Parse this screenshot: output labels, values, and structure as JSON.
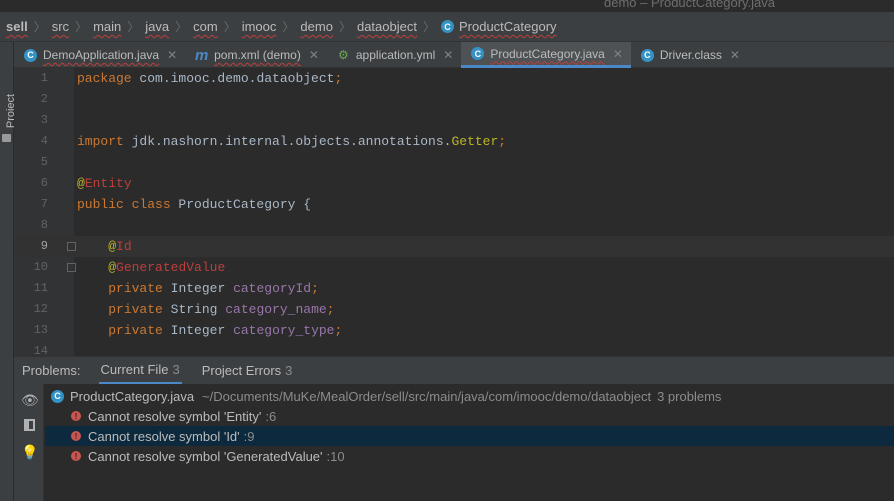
{
  "window": {
    "title": "demo – ProductCategory.java"
  },
  "breadcrumb": [
    "sell",
    "src",
    "main",
    "java",
    "com",
    "imooc",
    "demo",
    "dataobject",
    "ProductCategory"
  ],
  "sidebar": {
    "project_label": "Project"
  },
  "tabs": [
    {
      "label": "DemoApplication.java",
      "icon": "spring-app-icon"
    },
    {
      "label": "pom.xml (demo)",
      "icon": "maven-icon"
    },
    {
      "label": "application.yml",
      "icon": "yaml-icon"
    },
    {
      "label": "ProductCategory.java",
      "icon": "class-icon",
      "active": true
    },
    {
      "label": "Driver.class",
      "icon": "class-icon"
    }
  ],
  "editor": {
    "current_line": 9,
    "lines": [
      {
        "n": "1",
        "tokens": [
          [
            "kw",
            "package "
          ],
          [
            "pl",
            "com.imooc.demo.dataobject"
          ],
          [
            "kw",
            ";"
          ]
        ]
      },
      {
        "n": "2",
        "tokens": []
      },
      {
        "n": "3",
        "tokens": []
      },
      {
        "n": "4",
        "tokens": [
          [
            "kw",
            "import "
          ],
          [
            "pl",
            "jdk.nashorn.internal.objects.annotations."
          ],
          [
            "getter",
            "Getter"
          ],
          [
            "kw",
            ";"
          ]
        ]
      },
      {
        "n": "5",
        "tokens": []
      },
      {
        "n": "6",
        "tokens": [
          [
            "ann",
            "@"
          ],
          [
            "err",
            "Entity"
          ]
        ]
      },
      {
        "n": "7",
        "tokens": [
          [
            "kw",
            "public class "
          ],
          [
            "pl",
            "ProductCategory {"
          ]
        ]
      },
      {
        "n": "8",
        "tokens": []
      },
      {
        "n": "9",
        "tokens": [
          [
            "pl",
            "    "
          ],
          [
            "ann",
            "@"
          ],
          [
            "err",
            "Id"
          ]
        ],
        "fold": true
      },
      {
        "n": "10",
        "tokens": [
          [
            "pl",
            "    "
          ],
          [
            "ann",
            "@"
          ],
          [
            "err",
            "GeneratedValue"
          ]
        ],
        "fold": true
      },
      {
        "n": "11",
        "tokens": [
          [
            "pl",
            "    "
          ],
          [
            "kw",
            "private "
          ],
          [
            "pl",
            "Integer "
          ],
          [
            "fld",
            "categoryId"
          ],
          [
            "kw",
            ";"
          ]
        ]
      },
      {
        "n": "12",
        "tokens": [
          [
            "pl",
            "    "
          ],
          [
            "kw",
            "private "
          ],
          [
            "pl",
            "String "
          ],
          [
            "fld",
            "category_name"
          ],
          [
            "kw",
            ";"
          ]
        ]
      },
      {
        "n": "13",
        "tokens": [
          [
            "pl",
            "    "
          ],
          [
            "kw",
            "private "
          ],
          [
            "pl",
            "Integer "
          ],
          [
            "fld",
            "category_type"
          ],
          [
            "kw",
            ";"
          ]
        ]
      },
      {
        "n": "14",
        "tokens": []
      }
    ]
  },
  "problems": {
    "title": "Problems:",
    "tabs": [
      {
        "label": "Current File",
        "count": "3",
        "active": true
      },
      {
        "label": "Project Errors",
        "count": "3"
      }
    ],
    "file": {
      "name": "ProductCategory.java",
      "path": "~/Documents/MuKe/MealOrder/sell/src/main/java/com/imooc/demo/dataobject",
      "count": "3 problems"
    },
    "items": [
      {
        "message": "Cannot resolve symbol 'Entity'",
        "location": ":6"
      },
      {
        "message": "Cannot resolve symbol 'Id'",
        "location": ":9",
        "selected": true
      },
      {
        "message": "Cannot resolve symbol 'GeneratedValue'",
        "location": ":10"
      }
    ]
  },
  "colors": {
    "keyword": "#cc7832",
    "annotation": "#bbb529",
    "error": "#bc3f3c",
    "field": "#9876aa",
    "accent": "#4a88c7",
    "selection": "#0d293e"
  }
}
